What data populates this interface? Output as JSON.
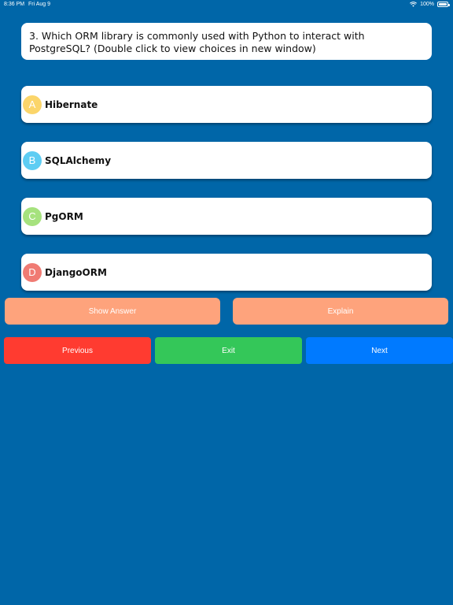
{
  "status_bar": {
    "time": "8:36 PM",
    "date": "Fri Aug 9",
    "battery": "100%"
  },
  "question": {
    "text": "3. Which ORM library is commonly used with Python to interact with PostgreSQL? (Double click to view choices in new window)"
  },
  "choices": [
    {
      "letter": "A",
      "text": "Hibernate",
      "color": "#fbd56a"
    },
    {
      "letter": "B",
      "text": "SQLAlchemy",
      "color": "#5ecdf3"
    },
    {
      "letter": "C",
      "text": "PgORM",
      "color": "#a6e27e"
    },
    {
      "letter": "D",
      "text": "DjangoORM",
      "color": "#f07b73"
    }
  ],
  "actions": {
    "show_answer": "Show Answer",
    "explain": "Explain"
  },
  "navigation": {
    "previous": "Previous",
    "exit": "Exit",
    "next": "Next"
  },
  "colors": {
    "background": "#0066a8",
    "action_button": "#fea37c",
    "previous": "#ff3b30",
    "exit": "#34c759",
    "next": "#007aff"
  }
}
